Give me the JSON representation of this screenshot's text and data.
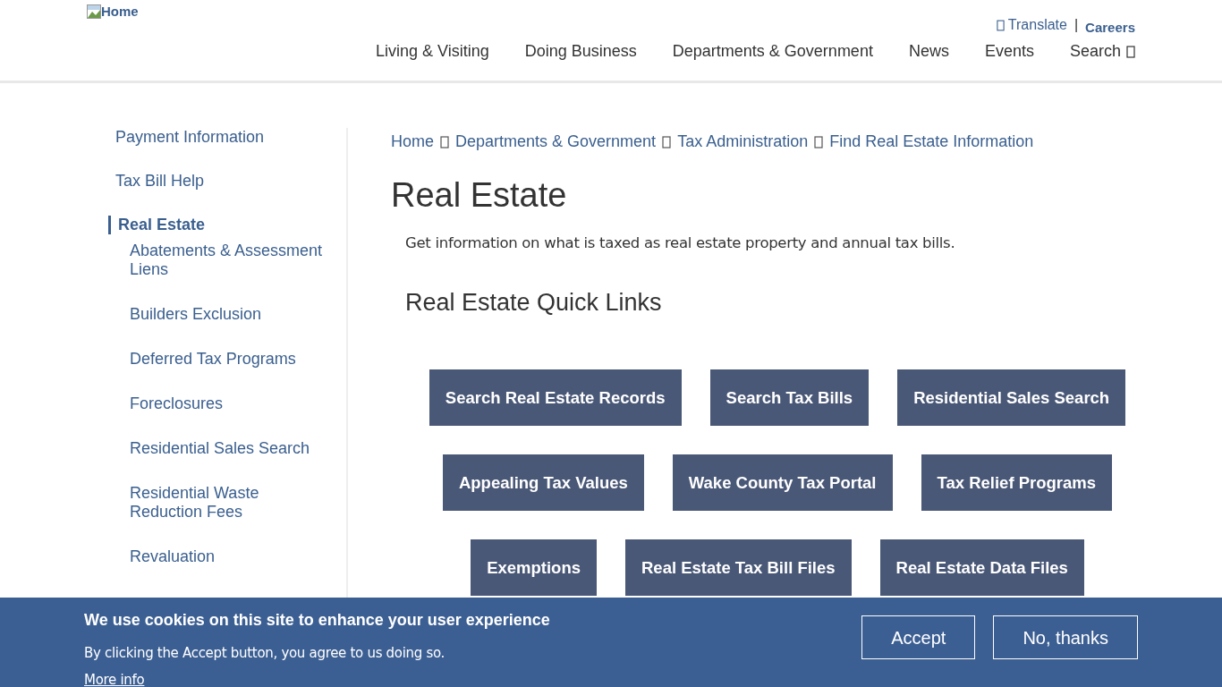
{
  "logo": {
    "alt": "Home"
  },
  "utility_separator": "|",
  "utility_links": [
    {
      "label": "Translate",
      "kind": "icon-link"
    },
    {
      "label": "Careers",
      "kind": "link"
    }
  ],
  "nav": [
    {
      "label": "Living & Visiting",
      "kind": "link"
    },
    {
      "label": "Doing Business",
      "kind": "link"
    },
    {
      "label": "Departments & Government",
      "kind": "link"
    },
    {
      "label": "News",
      "kind": "link"
    },
    {
      "label": "Events",
      "kind": "link"
    },
    {
      "label": "Search",
      "kind": "search"
    }
  ],
  "sidebar": {
    "items": [
      {
        "label": "Payment Information",
        "selected": false
      },
      {
        "label": "Tax Bill Help",
        "selected": false
      },
      {
        "label": "Real Estate",
        "selected": true,
        "children": [
          {
            "label": "Abatements & Assessment Liens",
            "selected": false
          },
          {
            "label": "Builders Exclusion",
            "selected": false
          },
          {
            "label": "Deferred Tax Programs",
            "selected": false
          },
          {
            "label": "Foreclosures",
            "selected": false
          },
          {
            "label": "Residential Sales Search",
            "selected": false
          },
          {
            "label": "Residential Waste Reduction Fees",
            "selected": false
          },
          {
            "label": "Revaluation",
            "selected": false
          }
        ]
      }
    ]
  },
  "breadcrumb": [
    "Home",
    "Departments & Government",
    "Tax Administration",
    "Find Real Estate Information"
  ],
  "title": "Real Estate",
  "intro": "Get information on what is taxed as real estate property and annual tax bills.",
  "quick_links": {
    "heading": "Real Estate Quick Links",
    "rows": [
      [
        "Search Real Estate Records",
        "Search Tax Bills",
        "Residential Sales Search"
      ],
      [
        "Appealing Tax Values",
        "Wake County Tax Portal",
        "Tax Relief Programs"
      ],
      [
        "Exemptions",
        "Real Estate Tax Bill Files",
        "Real Estate Data Files"
      ]
    ]
  },
  "cookie_banner": {
    "title": "We use cookies on this site to enhance your user experience",
    "text": "By clicking the Accept button, you agree to us doing so.",
    "more_info": "More info",
    "buttons": [
      "Accept",
      "No, thanks"
    ]
  }
}
